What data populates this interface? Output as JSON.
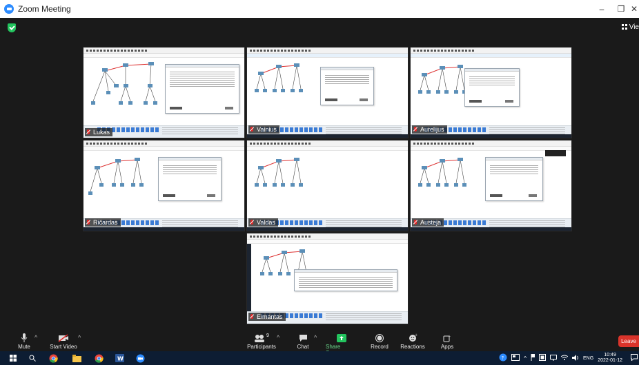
{
  "window": {
    "title": "Zoom Meeting",
    "controls": {
      "minimize": "–",
      "maximize": "❐",
      "close": "✕"
    }
  },
  "meeting": {
    "view_label": "Vie",
    "tiles": [
      {
        "name": "Lukas"
      },
      {
        "name": "Vainius"
      },
      {
        "name": "Aurelijus"
      },
      {
        "name": "Ričardas"
      },
      {
        "name": "Valdas"
      },
      {
        "name": "Austeja"
      },
      {
        "name": "Eimantas"
      }
    ]
  },
  "controls": {
    "mute_label": "Mute",
    "video_label": "Start Video",
    "participants_label": "Participants",
    "participants_count": "9",
    "chat_label": "Chat",
    "share_label": "Share Screen",
    "record_label": "Record",
    "reactions_label": "Reactions",
    "apps_label": "Apps",
    "leave_label": "Leave"
  },
  "taskbar": {
    "language": "ENG",
    "time": "10:49",
    "date": "2022-01-12"
  },
  "colors": {
    "zoom_blue": "#2d8cff",
    "share_green": "#23c45e",
    "leave_red": "#d9342b",
    "taskbar_bg": "#0d1d33"
  }
}
